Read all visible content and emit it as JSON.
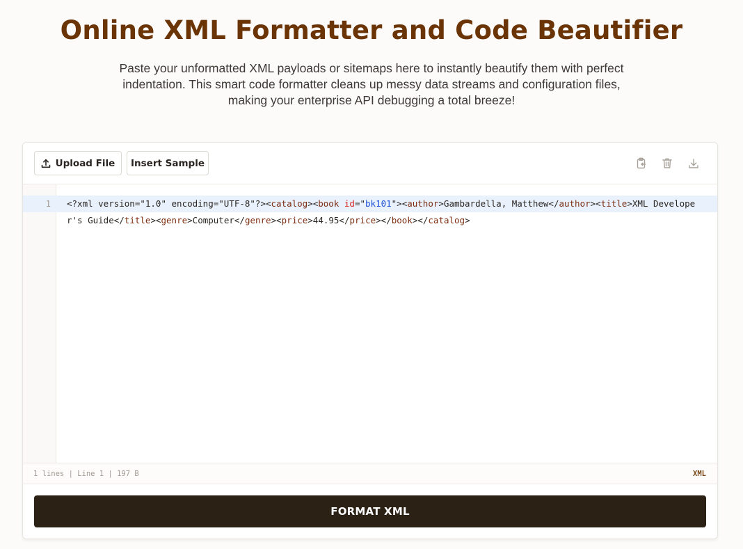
{
  "header": {
    "title": "Online XML Formatter and Code Beautifier",
    "subtitle": "Paste your unformatted XML payloads or sitemaps here to instantly beautify them with perfect indentation. This smart code formatter cleans up messy data streams and configuration files, making your enterprise API debugging a total breeze!"
  },
  "toolbar": {
    "upload_label": "Upload File",
    "sample_label": "Insert Sample",
    "icons": [
      "upload-icon",
      "paste-icon",
      "trash-icon",
      "download-icon"
    ]
  },
  "editor": {
    "line_number": "1",
    "code": "<?xml version=\"1.0\" encoding=\"UTF-8\"?><catalog><book id=\"bk101\"><author>Gambardella, Matthew</author><title>XML Developer's Guide</title><genre>Computer</genre><price>44.95</price></book></catalog>"
  },
  "status": {
    "info": "1 lines | Line 1 | 197 B",
    "language": "XML"
  },
  "action": {
    "format_label": "FORMAT XML"
  },
  "colors": {
    "title": "#6b3406",
    "button_dark": "#2b2115",
    "active_line": "#e8f1fc"
  }
}
